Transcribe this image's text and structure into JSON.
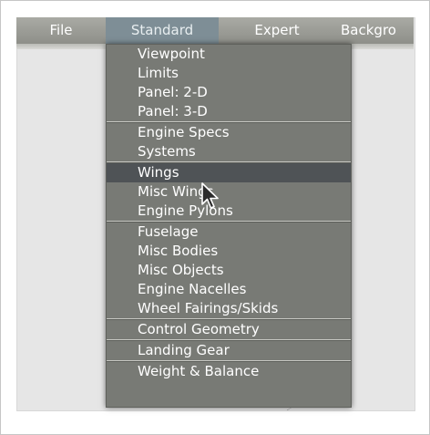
{
  "menubar": {
    "items": [
      "File",
      "Standard",
      "Expert",
      "Backgro"
    ]
  },
  "menu": {
    "groups": [
      [
        "Viewpoint",
        "Limits",
        "Panel: 2-D",
        "Panel: 3-D"
      ],
      [
        "Engine Specs",
        "Systems"
      ],
      [
        "Wings",
        "Misc Wings",
        "Engine Pylons"
      ],
      [
        "Fuselage",
        "Misc Bodies",
        "Misc Objects",
        "Engine Nacelles",
        "Wheel Fairings/Skids"
      ],
      [
        "Control Geometry"
      ],
      [
        "Landing Gear"
      ],
      [
        "Weight & Balance"
      ]
    ],
    "highlighted": "Wings"
  },
  "icons": {
    "cursor": "mouse-pointer-icon"
  },
  "colors": {
    "menubar": "#9c9d97",
    "active_menu": "#7e8e96",
    "dropdown": "#787a75",
    "highlight": "#4f5356"
  }
}
